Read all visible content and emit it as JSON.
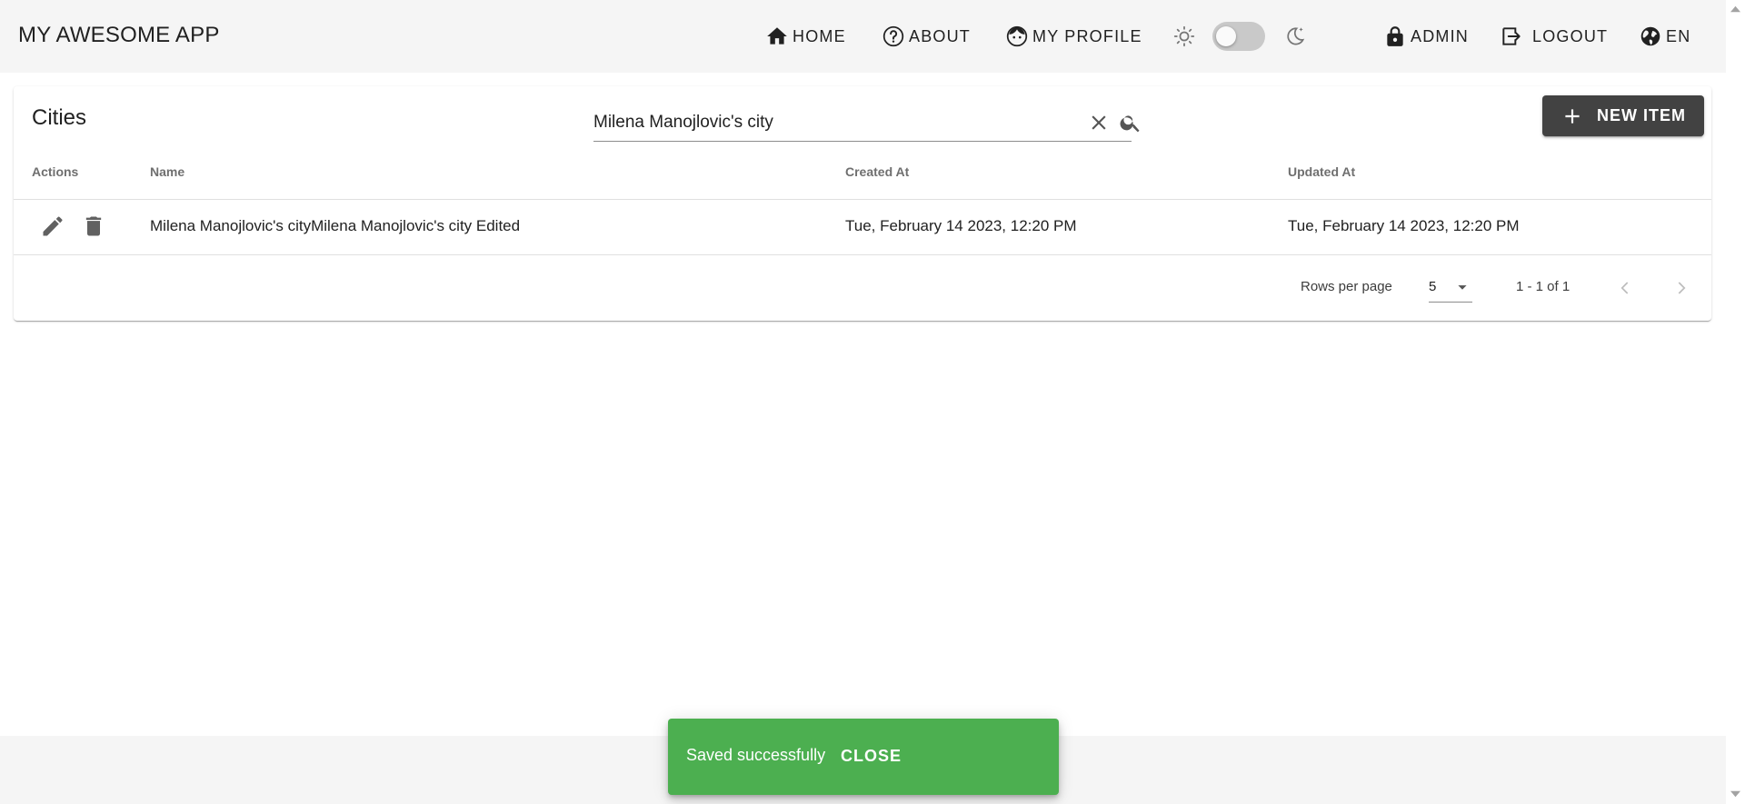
{
  "app": {
    "title": "MY AWESOME APP"
  },
  "nav": {
    "home": "HOME",
    "about": "ABOUT",
    "profile": "MY PROFILE",
    "admin": "ADMIN",
    "logout": "LOGOUT",
    "language": "EN"
  },
  "theme": {
    "dark_mode": false
  },
  "page": {
    "title": "Cities",
    "search_value": "Milena Manojlovic's city",
    "new_item_label": "NEW ITEM"
  },
  "table": {
    "columns": [
      "Actions",
      "Name",
      "Created At",
      "Updated At"
    ],
    "rows": [
      {
        "name": "Milena Manojlovic's cityMilena Manojlovic's city Edited",
        "created_at": "Tue, February 14 2023, 12:20 PM",
        "updated_at": "Tue, February 14 2023, 12:20 PM"
      }
    ]
  },
  "pagination": {
    "rows_per_page_label": "Rows per page",
    "rows_per_page": "5",
    "range": "1 - 1 of 1"
  },
  "snackbar": {
    "message": "Saved successfully",
    "action": "CLOSE",
    "color": "#4caf50"
  },
  "icons": [
    "home-icon",
    "help-circle-icon",
    "face-icon",
    "sun-icon",
    "moon-icon",
    "lock-icon",
    "logout-icon",
    "globe-icon",
    "close-icon",
    "search-icon",
    "plus-icon",
    "edit-icon",
    "delete-icon",
    "chevron-down-icon",
    "chevron-left-icon",
    "chevron-right-icon"
  ]
}
